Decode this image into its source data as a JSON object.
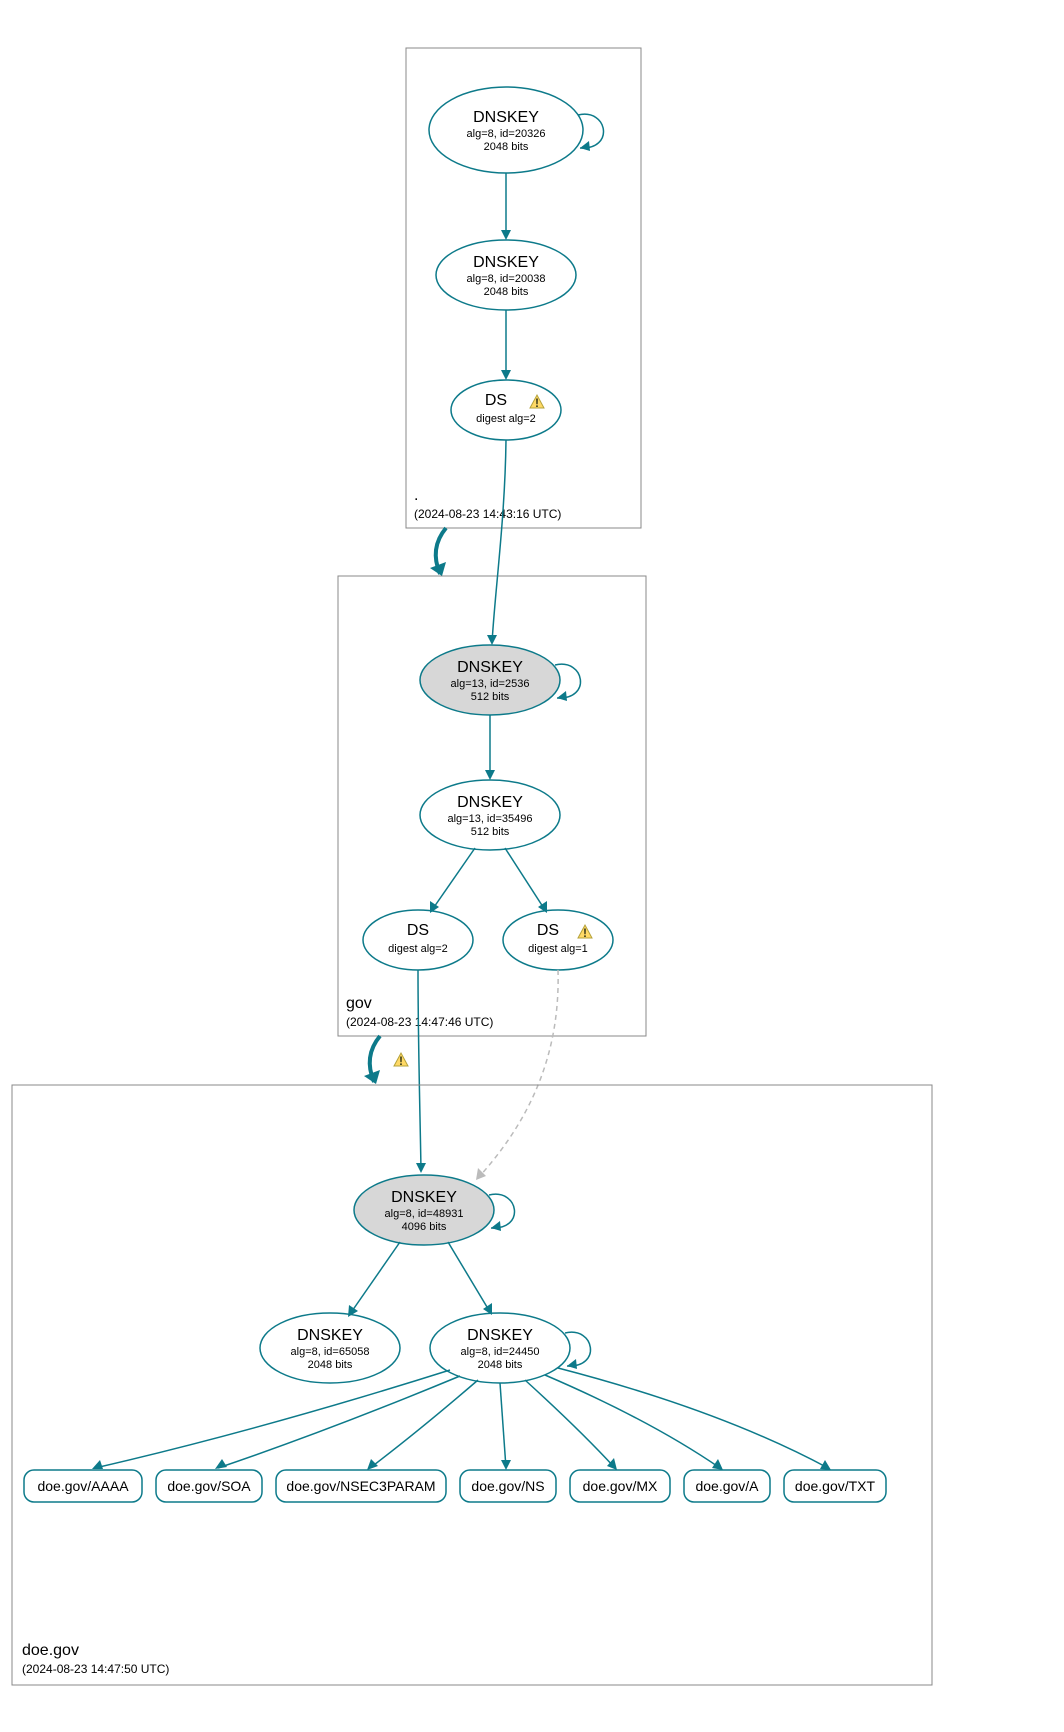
{
  "zones": {
    "root": {
      "name": ".",
      "timestamp": "(2024-08-23 14:43:16 UTC)"
    },
    "gov": {
      "name": "gov",
      "timestamp": "(2024-08-23 14:47:46 UTC)"
    },
    "doe": {
      "name": "doe.gov",
      "timestamp": "(2024-08-23 14:47:50 UTC)"
    }
  },
  "nodes": {
    "root_ksk": {
      "title": "DNSKEY",
      "line2": "alg=8, id=20326",
      "line3": "2048 bits"
    },
    "root_zsk": {
      "title": "DNSKEY",
      "line2": "alg=8, id=20038",
      "line3": "2048 bits"
    },
    "root_ds": {
      "title": "DS",
      "line2": "digest alg=2"
    },
    "gov_ksk": {
      "title": "DNSKEY",
      "line2": "alg=13, id=2536",
      "line3": "512 bits"
    },
    "gov_zsk": {
      "title": "DNSKEY",
      "line2": "alg=13, id=35496",
      "line3": "512 bits"
    },
    "gov_ds1": {
      "title": "DS",
      "line2": "digest alg=2"
    },
    "gov_ds2": {
      "title": "DS",
      "line2": "digest alg=1"
    },
    "doe_ksk": {
      "title": "DNSKEY",
      "line2": "alg=8, id=48931",
      "line3": "4096 bits"
    },
    "doe_zsk1": {
      "title": "DNSKEY",
      "line2": "alg=8, id=65058",
      "line3": "2048 bits"
    },
    "doe_zsk2": {
      "title": "DNSKEY",
      "line2": "alg=8, id=24450",
      "line3": "2048 bits"
    }
  },
  "rrsets": {
    "aaaa": "doe.gov/AAAA",
    "soa": "doe.gov/SOA",
    "nsec3": "doe.gov/NSEC3PARAM",
    "ns": "doe.gov/NS",
    "mx": "doe.gov/MX",
    "a": "doe.gov/A",
    "txt": "doe.gov/TXT"
  }
}
